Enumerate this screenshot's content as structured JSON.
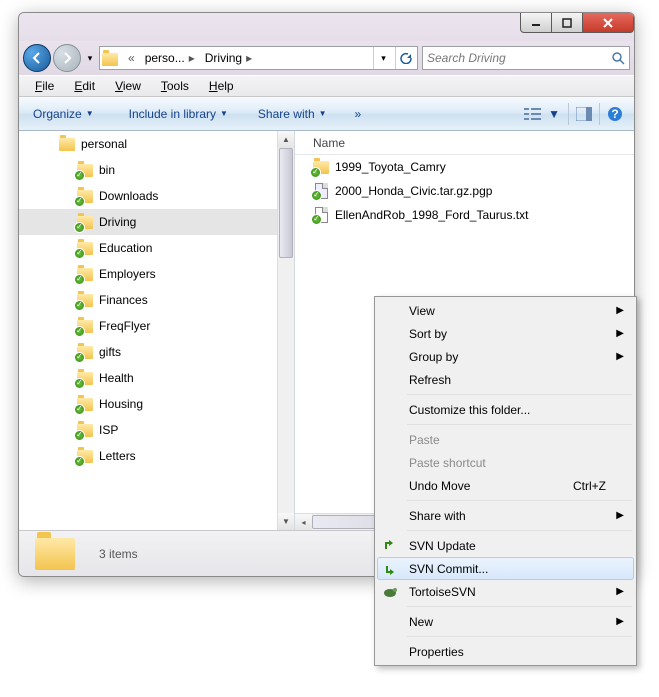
{
  "titlebar": {
    "minimize": "–",
    "maximize": "▢",
    "close": "✕"
  },
  "nav": {
    "back": "←",
    "forward": "→"
  },
  "breadcrumbs": {
    "root_chevron": "«",
    "items": [
      {
        "label": "perso..."
      },
      {
        "label": "Driving"
      }
    ]
  },
  "search": {
    "placeholder": "Search Driving",
    "iconText": "🔍"
  },
  "menubar": {
    "file": "File",
    "edit": "Edit",
    "view": "View",
    "tools": "Tools",
    "help": "Help"
  },
  "toolbar": {
    "organize": "Organize",
    "include": "Include in library",
    "share": "Share with",
    "more": "»"
  },
  "tree": {
    "root": "personal",
    "items": [
      "bin",
      "Downloads",
      "Driving",
      "Education",
      "Employers",
      "Finances",
      "FreqFlyer",
      "gifts",
      "Health",
      "Housing",
      "ISP",
      "Letters"
    ],
    "selected": "Driving"
  },
  "files": {
    "header": "Name",
    "items": [
      {
        "name": "1999_Toyota_Camry",
        "type": "folder"
      },
      {
        "name": "2000_Honda_Civic.tar.gz.pgp",
        "type": "file"
      },
      {
        "name": "EllenAndRob_1998_Ford_Taurus.txt",
        "type": "text"
      }
    ]
  },
  "statusbar": {
    "text": "3 items"
  },
  "context_menu": {
    "items": [
      {
        "label": "View",
        "sub": true
      },
      {
        "label": "Sort by",
        "sub": true
      },
      {
        "label": "Group by",
        "sub": true
      },
      {
        "label": "Refresh"
      },
      {
        "sep": true
      },
      {
        "label": "Customize this folder..."
      },
      {
        "sep": true
      },
      {
        "label": "Paste",
        "disabled": true
      },
      {
        "label": "Paste shortcut",
        "disabled": true
      },
      {
        "label": "Undo Move",
        "shortcut": "Ctrl+Z"
      },
      {
        "sep": true
      },
      {
        "label": "Share with",
        "sub": true
      },
      {
        "sep": true
      },
      {
        "label": "SVN Update",
        "icon": "svn-update"
      },
      {
        "label": "SVN Commit...",
        "icon": "svn-commit",
        "hover": true
      },
      {
        "label": "TortoiseSVN",
        "icon": "tortoise",
        "sub": true
      },
      {
        "sep": true
      },
      {
        "label": "New",
        "sub": true
      },
      {
        "sep": true
      },
      {
        "label": "Properties"
      }
    ]
  }
}
